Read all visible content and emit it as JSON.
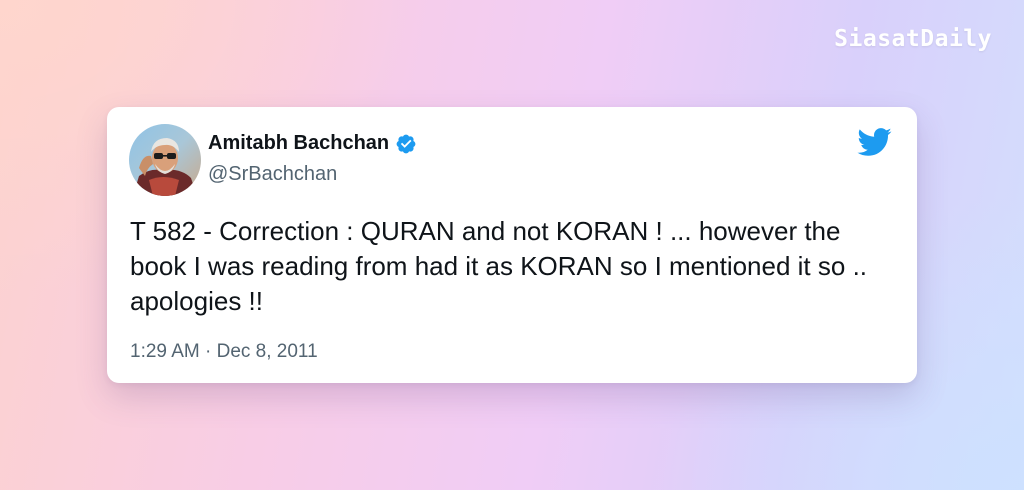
{
  "brand": {
    "name": "SiasatDaily"
  },
  "tweet": {
    "author_name": "Amitabh Bachchan",
    "handle": "@SrBachchan",
    "verified": true,
    "text": "T 582 - Correction : QURAN and not KORAN ! ... however the book I was reading from had it as KORAN so I mentioned it so .. apologies !!",
    "timestamp": "1:29 AM · Dec 8, 2011",
    "icons": {
      "verified": "verified-badge-icon",
      "platform": "twitter-bird-icon"
    }
  },
  "colors": {
    "twitter_blue": "#1d9bf0",
    "text_primary": "#0f1419",
    "text_secondary": "#536471",
    "brand_text": "#ffffff"
  }
}
